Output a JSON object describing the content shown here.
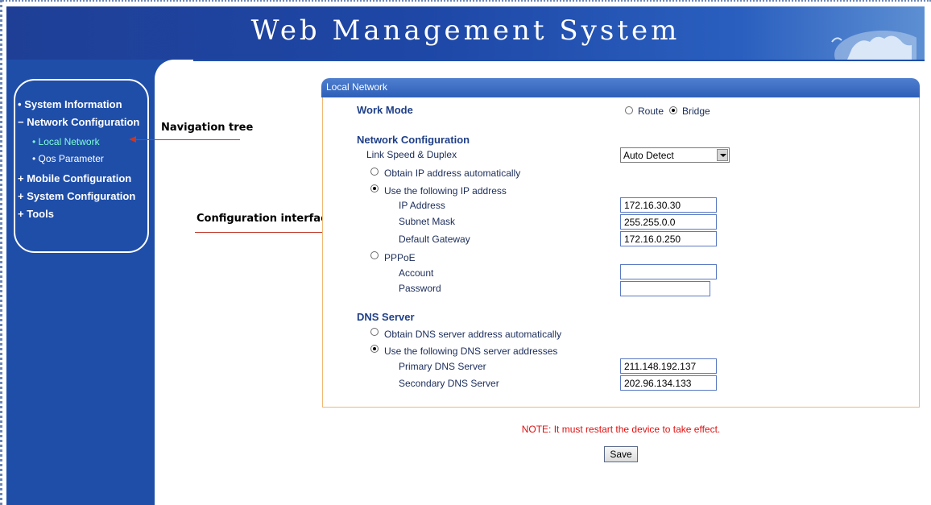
{
  "app": {
    "title": "Web Management System"
  },
  "nav": {
    "items": [
      {
        "bullet": "•",
        "label": "System Information"
      },
      {
        "bullet": "−",
        "label": "Network Configuration"
      },
      {
        "bullet": "+",
        "label": "Mobile Configuration"
      },
      {
        "bullet": "+",
        "label": "System Configuration"
      },
      {
        "bullet": "+",
        "label": "Tools"
      }
    ],
    "sub_items": [
      {
        "bullet": "•",
        "label": "Local Network",
        "active": true
      },
      {
        "bullet": "•",
        "label": "Qos Parameter",
        "active": false
      }
    ]
  },
  "annotations": {
    "nav_tree": "Navigation tree",
    "config_interface": "Configuration interface"
  },
  "panel": {
    "title": "Local Network",
    "work_mode": {
      "label": "Work Mode",
      "options": [
        "Route",
        "Bridge"
      ],
      "selected": "Bridge"
    },
    "network_config": {
      "heading": "Network Configuration",
      "link_speed_label": "Link Speed & Duplex",
      "link_speed_value": "Auto Detect",
      "obtain_auto_label": "Obtain IP address automatically",
      "use_following_label": "Use the following IP address",
      "ip_label": "IP Address",
      "ip_value": "172.16.30.30",
      "mask_label": "Subnet Mask",
      "mask_value": "255.255.0.0",
      "gateway_label": "Default Gateway",
      "gateway_value": "172.16.0.250",
      "pppoe_label": "PPPoE",
      "account_label": "Account",
      "account_value": "",
      "password_label": "Password",
      "password_value": ""
    },
    "dns": {
      "heading": "DNS Server",
      "obtain_auto_label": "Obtain DNS server address automatically",
      "use_following_label": "Use the following DNS server addresses",
      "primary_label": "Primary DNS Server",
      "primary_value": "211.148.192.137",
      "secondary_label": "Secondary DNS Server",
      "secondary_value": "202.96.134.133"
    }
  },
  "footer": {
    "note": "NOTE: It must restart the device to take effect.",
    "save_label": "Save"
  },
  "colors": {
    "banner_blue": "#1f3f96",
    "sidebar_blue": "#1f4ea9",
    "active_nav": "#7fffd4",
    "note_red": "#e01010",
    "panel_border": "#f0b877"
  }
}
